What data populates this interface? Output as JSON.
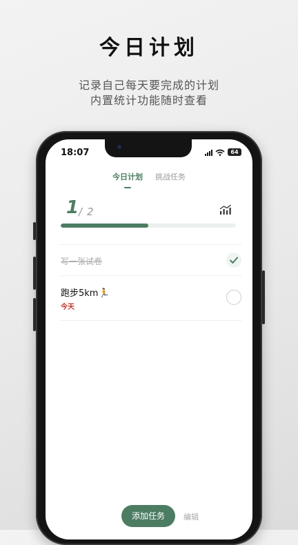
{
  "hero": {
    "title": "今日计划",
    "subtitle_line1": "记录自己每天要完成的计划",
    "subtitle_line2": "内置统计功能随时查看"
  },
  "status_bar": {
    "time": "18:07",
    "battery": "64",
    "icons": [
      "signal-icon",
      "wifi-icon",
      "battery-icon"
    ]
  },
  "tabs": [
    {
      "label": "今日计划",
      "active": true
    },
    {
      "label": "挑战任务",
      "active": false
    }
  ],
  "progress": {
    "done": "1",
    "separator": "/",
    "total": "2",
    "fraction": 0.5
  },
  "tasks": [
    {
      "title": "写一张试卷",
      "date": "",
      "completed": true
    },
    {
      "title": "跑步5km🏃",
      "date": "今天",
      "completed": false
    }
  ],
  "actions": {
    "add_label": "添加任务",
    "edit_label": "编辑"
  },
  "colors": {
    "accent": "#4c7d63",
    "date_red": "#c0392b"
  }
}
